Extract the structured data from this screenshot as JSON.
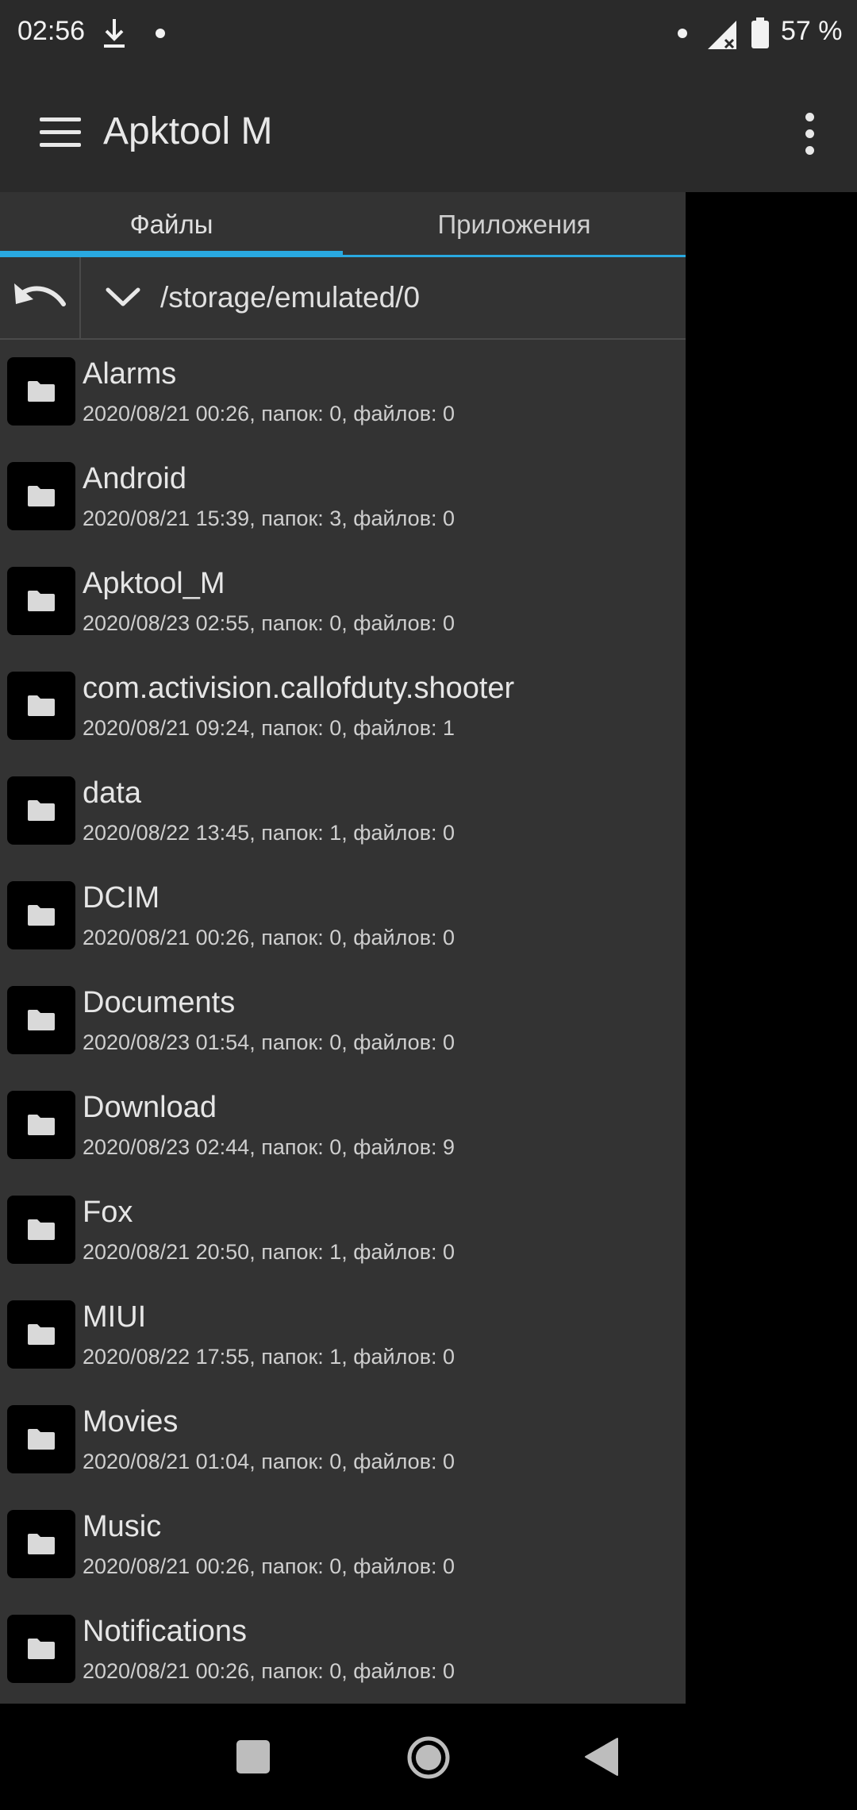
{
  "status": {
    "time": "02:56",
    "battery": "57 %"
  },
  "appbar": {
    "title": "Apktool M"
  },
  "tabs": [
    {
      "label": "Файлы",
      "active": true
    },
    {
      "label": "Приложения",
      "active": false
    }
  ],
  "path": "/storage/emulated/0",
  "files": [
    {
      "name": "Alarms",
      "meta": "2020/08/21 00:26, папок: 0, файлов: 0"
    },
    {
      "name": "Android",
      "meta": "2020/08/21 15:39, папок: 3, файлов: 0"
    },
    {
      "name": "Apktool_M",
      "meta": "2020/08/23 02:55, папок: 0, файлов: 0"
    },
    {
      "name": "com.activision.callofduty.shooter",
      "meta": "2020/08/21 09:24, папок: 0, файлов: 1"
    },
    {
      "name": "data",
      "meta": "2020/08/22 13:45, папок: 1, файлов: 0"
    },
    {
      "name": "DCIM",
      "meta": "2020/08/21 00:26, папок: 0, файлов: 0"
    },
    {
      "name": "Documents",
      "meta": "2020/08/23 01:54, папок: 0, файлов: 0"
    },
    {
      "name": "Download",
      "meta": "2020/08/23 02:44, папок: 0, файлов: 9"
    },
    {
      "name": "Fox",
      "meta": "2020/08/21 20:50, папок: 1, файлов: 0"
    },
    {
      "name": "MIUI",
      "meta": "2020/08/22 17:55, папок: 1, файлов: 0"
    },
    {
      "name": "Movies",
      "meta": "2020/08/21 01:04, папок: 0, файлов: 0"
    },
    {
      "name": "Music",
      "meta": "2020/08/21 00:26, папок: 0, файлов: 0"
    },
    {
      "name": "Notifications",
      "meta": "2020/08/21 00:26, папок: 0, файлов: 0"
    }
  ],
  "colors": {
    "accent": "#29a9e1",
    "panel": "#333333",
    "bar": "#2a2a2a"
  }
}
